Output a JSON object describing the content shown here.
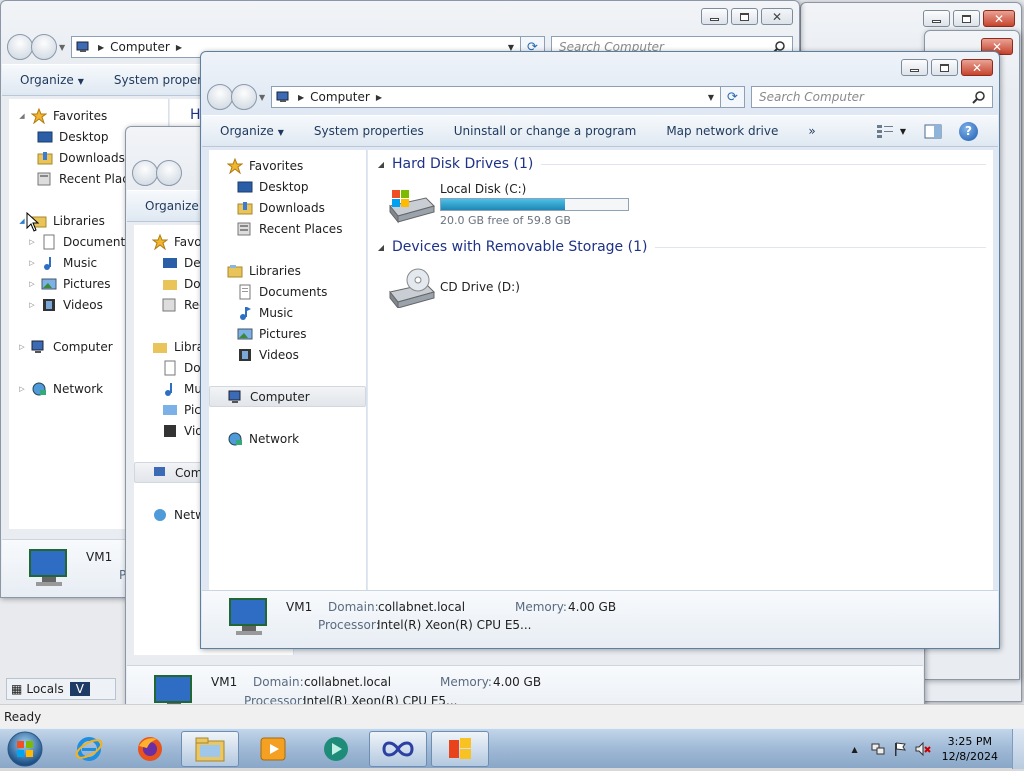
{
  "address": {
    "location": "Computer",
    "search_placeholder": "Search Computer"
  },
  "toolbar": {
    "organize": "Organize",
    "system_properties": "System properties",
    "system_properties_cut": "System properti",
    "uninstall": "Uninstall or change a program",
    "map_drive": "Map network drive",
    "more": "»",
    "help": "?"
  },
  "nav": {
    "favorites": "Favorites",
    "desktop": "Desktop",
    "downloads": "Downloads",
    "recent": "Recent Places",
    "recent_cut": "Recent Place",
    "libraries": "Libraries",
    "documents": "Documents",
    "music": "Music",
    "pictures": "Pictures",
    "videos": "Videos",
    "computer": "Computer",
    "network": "Network"
  },
  "content": {
    "hdd_group": "Hard Disk Drives (1)",
    "local_disk": "Local Disk (C:)",
    "local_disk_free": "20.0 GB free of 59.8 GB",
    "local_disk_used_fraction": 0.665,
    "removable_group": "Devices with Removable Storage (1)",
    "cd_drive": "CD Drive (D:)"
  },
  "details": {
    "name": "VM1",
    "domain_label": "Domain:",
    "domain_value": "collabnet.local",
    "memory_label": "Memory:",
    "memory_value": "4.00 GB",
    "processor_label": "Processor:",
    "processor_value": "Intel(R) Xeon(R) CPU E5..."
  },
  "background": {
    "status_ready": "Ready",
    "locals_tab": "Locals",
    "v_tab": "V",
    "h_partial": "H",
    "p_partial": "P"
  },
  "taskbar": {
    "time": "3:25 PM",
    "date": "12/8/2024"
  }
}
